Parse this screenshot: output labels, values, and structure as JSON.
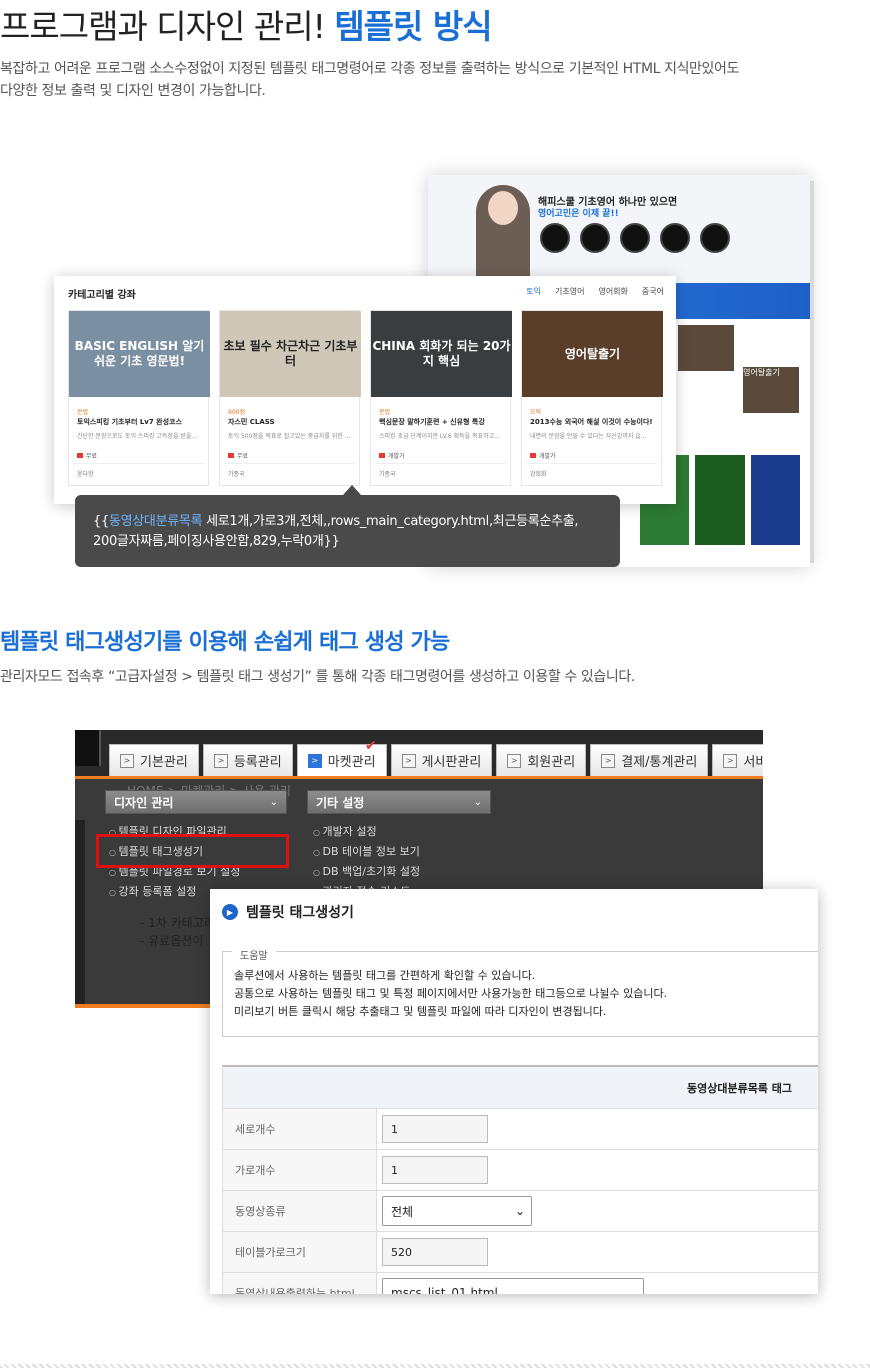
{
  "section1": {
    "title_main": "프로그램과 디자인 관리! ",
    "title_highlight": "템플릿 방식",
    "lead_line1": "복잡하고 어려운 프로그램 소스수정없이 지정된  템플릿 태그명령어로 각종 정보를 출력하는 방식으로 기본적인 HTML 지식만있어도",
    "lead_line2": "다양한 정보 출력 및 디자인 변경이 가능합니다."
  },
  "back_site": {
    "title": "해피스쿨 기초영어 하나만 있으면",
    "subtitle": "영어고민은 이제 끝!!",
    "thumb_label": "영어탈출기"
  },
  "course_panel": {
    "title": "카테고리별 강좌",
    "tabs": [
      "토익",
      "기초영어",
      "영어회화",
      "중국어"
    ],
    "courses": [
      {
        "thumb_text": "BASIC ENGLISH 알기 쉬운 기초 영문법!",
        "category": "문법",
        "name": "토익스피킹 기초부터 Lv7 완성코스",
        "desc": "간단한 문장으로도 토익 스피킹 고득점을 받을...",
        "price": "무료",
        "teacher": "윤다항",
        "color": "#7b8fa3"
      },
      {
        "thumb_text": "초보 필수 차근차근 기초부터",
        "category": "900점",
        "name": "자스민 CLASS",
        "desc": "토익 500점을 목표로 잡고있는 중급자를 위한 ...",
        "price": "무료",
        "teacher": "기종국",
        "color": "#cfc8b9"
      },
      {
        "thumb_text": "CHINA 회화가 되는 20가지 핵심",
        "category": "문법",
        "name": "핵심문장 말하기훈련 + 신유형 특강",
        "desc": "스피킹 초급 단계이지만 LV.6 획득을 목표하고...",
        "price": "개발가",
        "teacher": "기종국",
        "color": "#3a3d40"
      },
      {
        "thumb_text": "영어탈출기",
        "category": "오픽",
        "name": "2013수능 외국어 해설 이것이 수능이다!",
        "desc": "내면의 문장을 만들 수 있다는 자신감까지 습...",
        "price": "개발가",
        "teacher": "강희화",
        "color": "#5a3e2a"
      }
    ]
  },
  "tooltip": {
    "open": "{{",
    "keyword": "동영상대분류목록",
    "rest_line1": " 세로1개,가로3개,전체,,rows_main_category.html,최근등록순추출,",
    "line2": "200글자짜름,페이징사용안함,829,누락0개}}"
  },
  "section2": {
    "title": "템플릿 태그생성기를 이용해 손쉽게 태그 생성 가능",
    "lead": "관리자모드 접속후 “고급자설정 > 템플릿 태그 생성기” 를 통해 각종 태그명령어를 생성하고 이용할 수 있습니다."
  },
  "admin": {
    "tabs": [
      "기본관리",
      "등록관리",
      "마켓관리",
      "게시판관리",
      "회원관리",
      "결제/통계관리",
      "서비스"
    ],
    "active_tab": "마켓관리",
    "breadcrumb": "HOME > 마켓관리 > 사용 관리",
    "dropdown1": "디자인 관리",
    "dropdown2": "기타 설정",
    "menu1": [
      "템플릿 디자인 파일관리",
      "템플릿 태그생성기",
      "템플릿 파일경로 보기 설정",
      "강좌 등록폼 설정"
    ],
    "menu2": [
      "개발자 설정",
      "DB 테이블 정보 보기",
      "DB 백업/초기화 설정",
      "관리자 접속 리스트"
    ],
    "ghost_lines": [
      "- 1차 카테고리",
      "- 유료옵션이"
    ]
  },
  "dialog": {
    "title": "템플릿 태그생성기",
    "help_legend": "도움말",
    "help_lines": [
      "솔루션에서 사용하는 템플릿 태그를 간편하게 확인할 수 있습니다.",
      "공통으로 사용하는 템플릿 태그 및 특정 페이지에서만 사용가능한 태그등으로 나뉠수 있습니다.",
      "미리보기 버튼 클릭시 해당 추출태그 및 템플릿 파일에 따라 디자인이 변경됩니다."
    ],
    "table_header": "동영상대분류목록 태그",
    "rows": [
      {
        "label": "세로개수",
        "value": "1"
      },
      {
        "label": "가로개수",
        "value": "1"
      },
      {
        "label": "동영상종류",
        "value": "전체"
      },
      {
        "label": "테이블가로크기",
        "value": "520"
      },
      {
        "label": "동영상내용출력하는 html",
        "value": "mscs_list_01.html"
      }
    ]
  }
}
